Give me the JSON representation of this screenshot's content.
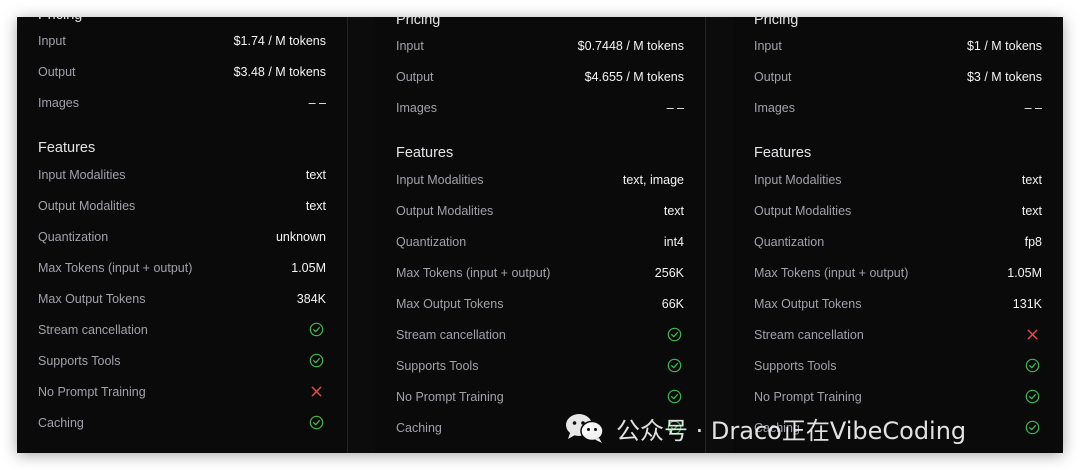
{
  "colors": {
    "check": "#3fb950",
    "cross": "#f04848"
  },
  "cards": [
    {
      "pricing_title": "Pricing",
      "pricing": [
        {
          "label": "Input",
          "value": "$1.74 / M tokens"
        },
        {
          "label": "Output",
          "value": "$3.48 / M tokens"
        },
        {
          "label": "Images",
          "value": "– –"
        }
      ],
      "features_title": "Features",
      "features": [
        {
          "label": "Input Modalities",
          "value": "text"
        },
        {
          "label": "Output Modalities",
          "value": "text"
        },
        {
          "label": "Quantization",
          "value": "unknown"
        },
        {
          "label": "Max Tokens (input + output)",
          "value": "1.05M"
        },
        {
          "label": "Max Output Tokens",
          "value": "384K"
        }
      ],
      "flags": [
        {
          "label": "Stream cancellation",
          "icon": "check-circle-icon"
        },
        {
          "label": "Supports Tools",
          "icon": "check-circle-icon"
        },
        {
          "label": "No Prompt Training",
          "icon": "x-icon"
        },
        {
          "label": "Caching",
          "icon": "check-circle-icon"
        }
      ]
    },
    {
      "pricing_title": "Pricing",
      "pricing": [
        {
          "label": "Input",
          "value": "$0.7448 / M tokens"
        },
        {
          "label": "Output",
          "value": "$4.655 / M tokens"
        },
        {
          "label": "Images",
          "value": "– –"
        }
      ],
      "features_title": "Features",
      "features": [
        {
          "label": "Input Modalities",
          "value": "text, image"
        },
        {
          "label": "Output Modalities",
          "value": "text"
        },
        {
          "label": "Quantization",
          "value": "int4"
        },
        {
          "label": "Max Tokens (input + output)",
          "value": "256K"
        },
        {
          "label": "Max Output Tokens",
          "value": "66K"
        }
      ],
      "flags": [
        {
          "label": "Stream cancellation",
          "icon": "check-circle-icon"
        },
        {
          "label": "Supports Tools",
          "icon": "check-circle-icon"
        },
        {
          "label": "No Prompt Training",
          "icon": "check-circle-icon"
        },
        {
          "label": "Caching",
          "icon": "check-circle-icon"
        }
      ]
    },
    {
      "pricing_title": "Pricing",
      "pricing": [
        {
          "label": "Input",
          "value": "$1 / M tokens"
        },
        {
          "label": "Output",
          "value": "$3 / M tokens"
        },
        {
          "label": "Images",
          "value": "– –"
        }
      ],
      "features_title": "Features",
      "features": [
        {
          "label": "Input Modalities",
          "value": "text"
        },
        {
          "label": "Output Modalities",
          "value": "text"
        },
        {
          "label": "Quantization",
          "value": "fp8"
        },
        {
          "label": "Max Tokens (input + output)",
          "value": "1.05M"
        },
        {
          "label": "Max Output Tokens",
          "value": "131K"
        }
      ],
      "flags": [
        {
          "label": "Stream cancellation",
          "icon": "x-icon"
        },
        {
          "label": "Supports Tools",
          "icon": "check-circle-icon"
        },
        {
          "label": "No Prompt Training",
          "icon": "check-circle-icon"
        },
        {
          "label": "Caching",
          "icon": "check-circle-icon"
        }
      ]
    }
  ],
  "watermark": {
    "text": "公众号 · Draco正在VibeCoding",
    "icon": "wechat-icon"
  }
}
